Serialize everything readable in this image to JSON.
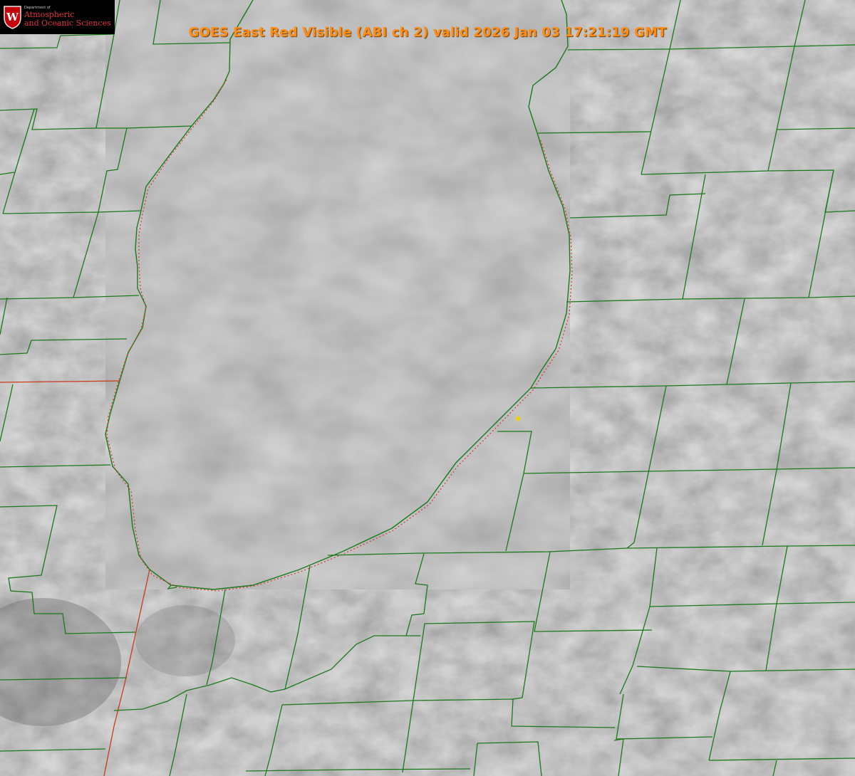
{
  "title": "GOES East Red Visible (ABI ch 2) valid 2026 Jan 03 17:21:19 GMT",
  "colors": {
    "title": "#ff8c14",
    "county_border": "#1a7a1a",
    "state_border": "#cc3a1a",
    "shoreline_dotted": "#e03030",
    "station_marker": "#e8d020",
    "lake": "#848484",
    "land": "#8c8c8c",
    "logo_red": "#c5050c"
  },
  "logo": {
    "line1": "Department of",
    "line2": "Atmospheric",
    "line3": "and Oceanic Sciences",
    "crest_letter": "W"
  },
  "map": {
    "features": [
      "lake",
      "county-borders",
      "state-borders",
      "station-marker"
    ],
    "icons": [
      "uw-crest-icon"
    ]
  }
}
